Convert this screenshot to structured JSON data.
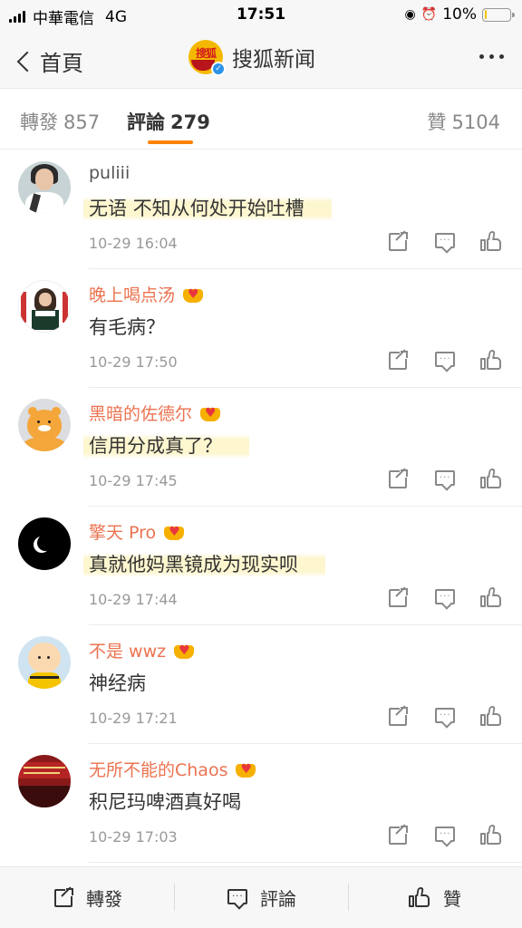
{
  "status_bar": {
    "carrier": "中華電信",
    "network": "4G",
    "time": "17:51",
    "battery": "10%",
    "battery_level": 0.1
  },
  "nav": {
    "back_label": "首頁",
    "title": "搜狐新闻",
    "avatar_text": "搜狐"
  },
  "tabs": {
    "reposts_label": "轉發",
    "reposts_count": "857",
    "comments_label": "評論",
    "comments_count": "279",
    "likes_label": "贊",
    "likes_count": "5104"
  },
  "comments": [
    {
      "name": "puliii",
      "text": "无语 不知从何处开始吐槽",
      "time": "10-29 16:04"
    },
    {
      "name": "晚上喝点汤",
      "text": "有毛病？",
      "time": "10-29 17:50"
    },
    {
      "name": "黑暗的佐德尔",
      "text": "信用分成真了？",
      "time": "10-29 17:45"
    },
    {
      "name": "擎天 Pro",
      "text": "真就他妈黑镜成为现实呗",
      "time": "10-29 17:44"
    },
    {
      "name": "不是 wwz",
      "text": "神经病",
      "time": "10-29 17:21"
    },
    {
      "name": "无所不能的Chaos",
      "text": "积尼玛啤酒真好喝",
      "time": "10-29 17:03"
    }
  ],
  "bottom_bar": {
    "repost_label": "轉發",
    "comment_label": "評論",
    "like_label": "贊"
  },
  "colors": {
    "accent": "#ff8200",
    "username": "#eb7350",
    "highlight": "#fdf6cf"
  }
}
